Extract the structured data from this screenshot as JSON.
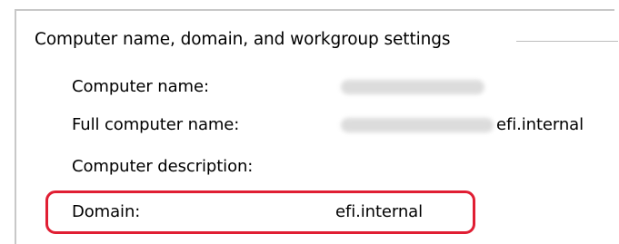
{
  "group": {
    "title": "Computer name, domain, and workgroup settings"
  },
  "rows": {
    "computer_name": {
      "label": "Computer name:",
      "value": ""
    },
    "full_computer_name": {
      "label": "Full computer name:",
      "value_suffix": "efi.internal"
    },
    "computer_description": {
      "label": "Computer description:",
      "value": ""
    },
    "domain": {
      "label": "Domain:",
      "value": "efi.internal"
    }
  },
  "colors": {
    "highlight_border": "#e01e33",
    "group_line": "#bdbdbd",
    "panel_border": "#c8c8c8",
    "redaction": "#d9d9d9"
  }
}
